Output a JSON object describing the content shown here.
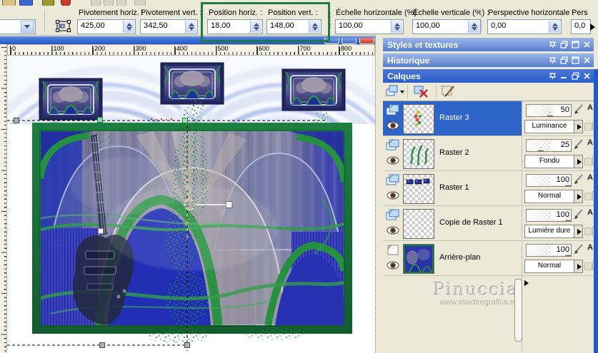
{
  "toolbar": {
    "preset_value": "",
    "fields": [
      {
        "label": "Pivotement horiz. :",
        "value": "425,00"
      },
      {
        "label": "Pivotement vert. :",
        "value": "342,50"
      },
      {
        "label": "Position horiz. :",
        "value": "18,00"
      },
      {
        "label": "Position vert. :",
        "value": "148,00"
      },
      {
        "label": "Échelle horizontale (%) :",
        "value": "100,00"
      },
      {
        "label": "Échelle verticale (%) :",
        "value": "100,00"
      },
      {
        "label": "Perspective horizontale :",
        "value": "0,00"
      },
      {
        "label": "Pers",
        "value": "0,0"
      }
    ]
  },
  "panels": {
    "styles_title": "Styles et textures",
    "history_title": "Historique",
    "layers_title": "Calques"
  },
  "layers": [
    {
      "name": "Raster 3",
      "opacity": "50",
      "blend": "Luminance"
    },
    {
      "name": "Raster 2",
      "opacity": "25",
      "blend": "Fondu"
    },
    {
      "name": "Raster 1",
      "opacity": "100",
      "blend": "Normal"
    },
    {
      "name": "Copie de Raster 1",
      "opacity": "100",
      "blend": "Lumière dure"
    },
    {
      "name": "Arrière-plan",
      "opacity": "100",
      "blend": "Normal"
    }
  ],
  "controls": {
    "brush_label": "A"
  },
  "ruler": {
    "labels": [
      "0",
      "100",
      "200",
      "300",
      "400",
      "500",
      "600",
      "700",
      "800"
    ]
  },
  "watermark": {
    "name": "Pinuccia",
    "site": "www.maidiregrafica.eu"
  },
  "colors": {
    "highlight_green": "#1f7a46",
    "selection_blue": "#2e63c8",
    "frame_green": "#1a7a3e"
  }
}
